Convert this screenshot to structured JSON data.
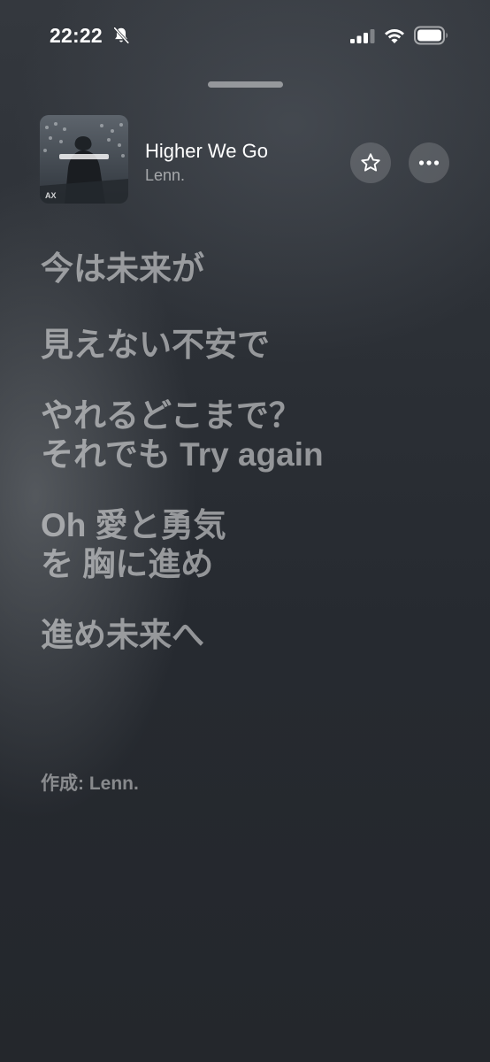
{
  "status_bar": {
    "time": "22:22",
    "icons": [
      "bell-slash-icon",
      "cellular-signal-icon",
      "wifi-icon",
      "battery-icon"
    ]
  },
  "now_playing": {
    "title": "Higher We Go",
    "artist": "Lenn.",
    "artwork": "album-artwork",
    "actions": {
      "favorite": "star-icon",
      "more": "ellipsis-icon"
    }
  },
  "lyrics": {
    "blocks": [
      {
        "lines": [
          "今は未来が"
        ]
      },
      {
        "lines": [
          "見えない不安で"
        ]
      },
      {
        "lines": [
          "やれるどこまで？",
          "それでも Try again"
        ]
      },
      {
        "lines": [
          "Oh 愛と勇気",
          "を 胸に進め"
        ]
      },
      {
        "lines": [
          "進め未来へ"
        ]
      }
    ],
    "credits": "作成: Lenn."
  },
  "colors": {
    "background_top": "#34383e",
    "background_bottom": "#24272c",
    "text_primary": "#ffffff",
    "lyric_inactive": "rgba(255,255,255,0.5)"
  }
}
